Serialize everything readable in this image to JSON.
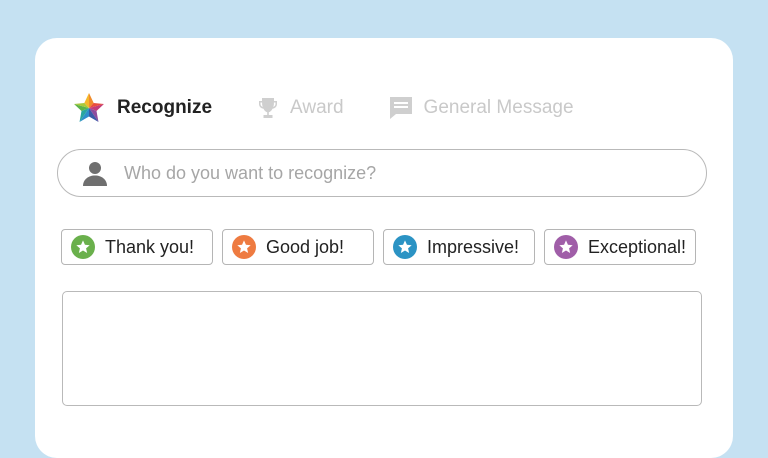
{
  "tabs": [
    {
      "label": "Recognize",
      "icon": "multicolor-star-icon",
      "active": true
    },
    {
      "label": "Award",
      "icon": "trophy-icon",
      "active": false
    },
    {
      "label": "General Message",
      "icon": "chat-bubble-icon",
      "active": false
    }
  ],
  "recipient": {
    "placeholder": "Who do you want to recognize?",
    "icon": "person-icon"
  },
  "badges": [
    {
      "label": "Thank you!",
      "color": "#6ab04c"
    },
    {
      "label": "Good job!",
      "color": "#ee7b41"
    },
    {
      "label": "Impressive!",
      "color": "#2b93c4"
    },
    {
      "label": "Exceptional!",
      "color": "#a05ea8"
    }
  ],
  "message": {
    "value": ""
  },
  "colors": {
    "background": "#c5e1f2",
    "card": "#ffffff",
    "inactive_tab": "#c9c9c9"
  }
}
